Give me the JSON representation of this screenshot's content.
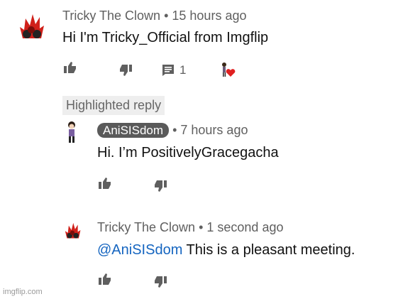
{
  "comment": {
    "author": "Tricky The Clown",
    "separator": "•",
    "time": "15 hours ago",
    "text": "Hi I'm Tricky_Official from Imgflip",
    "reply_count": "1"
  },
  "highlighted_label": "Highlighted reply",
  "reply1": {
    "author": "AniSISdom",
    "separator": "•",
    "time": "7 hours ago",
    "text": "Hi. I’m PositivelyGracegacha"
  },
  "reply2": {
    "author": "Tricky The Clown",
    "separator": "•",
    "time": "1 second ago",
    "mention": "@AniSISdom",
    "text": " This is a pleasant meeting."
  },
  "watermark": "imgflip.com",
  "icons": [
    "thumbs-up-icon",
    "thumbs-down-icon",
    "comment-icon",
    "creator-heart-icon"
  ],
  "colors": {
    "mention": "#1565c0",
    "chip": "#5a5a5a",
    "heart": "#e02020",
    "avatar_red": "#d0201a"
  }
}
